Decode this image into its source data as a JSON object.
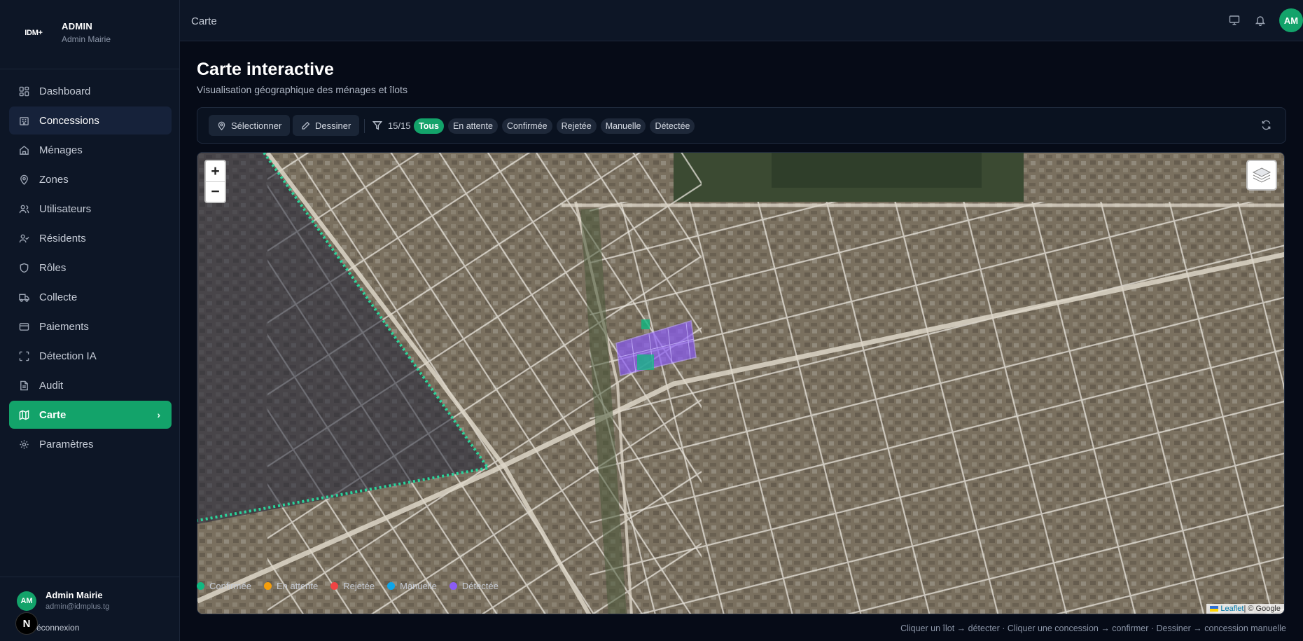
{
  "sidebar": {
    "logo": "IDM+",
    "title": "ADMIN",
    "subtitle": "Admin Mairie",
    "items": [
      {
        "label": "Dashboard",
        "icon": "dashboard-icon"
      },
      {
        "label": "Concessions",
        "icon": "building-icon"
      },
      {
        "label": "Ménages",
        "icon": "home-icon"
      },
      {
        "label": "Zones",
        "icon": "map-pin-icon"
      },
      {
        "label": "Utilisateurs",
        "icon": "users-icon"
      },
      {
        "label": "Résidents",
        "icon": "user-check-icon"
      },
      {
        "label": "Rôles",
        "icon": "shield-icon"
      },
      {
        "label": "Collecte",
        "icon": "truck-icon"
      },
      {
        "label": "Paiements",
        "icon": "credit-card-icon"
      },
      {
        "label": "Détection IA",
        "icon": "scan-icon"
      },
      {
        "label": "Audit",
        "icon": "file-text-icon"
      },
      {
        "label": "Carte",
        "icon": "map-icon"
      },
      {
        "label": "Paramètres",
        "icon": "gear-icon"
      }
    ],
    "user": {
      "initials": "AM",
      "name": "Admin Mairie",
      "email": "admin@idmplus.tg",
      "logout": "éconnexion",
      "badge": "N"
    }
  },
  "topbar": {
    "breadcrumb": "Carte",
    "avatar": "AM"
  },
  "page": {
    "title": "Carte interactive",
    "subtitle": "Visualisation géographique des ménages et îlots"
  },
  "toolbar": {
    "select_label": "Sélectionner",
    "draw_label": "Dessiner",
    "count": "15/15",
    "chips": [
      "Tous",
      "En attente",
      "Confirmée",
      "Rejetée",
      "Manuelle",
      "Détectée"
    ],
    "active_chip": "Tous"
  },
  "map": {
    "zoom_in": "+",
    "zoom_out": "−",
    "attribution_leaflet": "Leaflet",
    "attribution_rest": " | © Google"
  },
  "legend": [
    {
      "label": "Confirmée",
      "color": "#10b981"
    },
    {
      "label": "En attente",
      "color": "#f59e0b"
    },
    {
      "label": "Rejetée",
      "color": "#ef4444"
    },
    {
      "label": "Manuelle",
      "color": "#0ea5e9"
    },
    {
      "label": "Détectée",
      "color": "#8b5cf6"
    }
  ],
  "hint": "Cliquer un îlot → détecter · Cliquer une concession → confirmer · Dessiner → concession manuelle",
  "colors": {
    "accent": "#13a36a",
    "background": "#060b17",
    "sidebar": "#0d1626"
  }
}
